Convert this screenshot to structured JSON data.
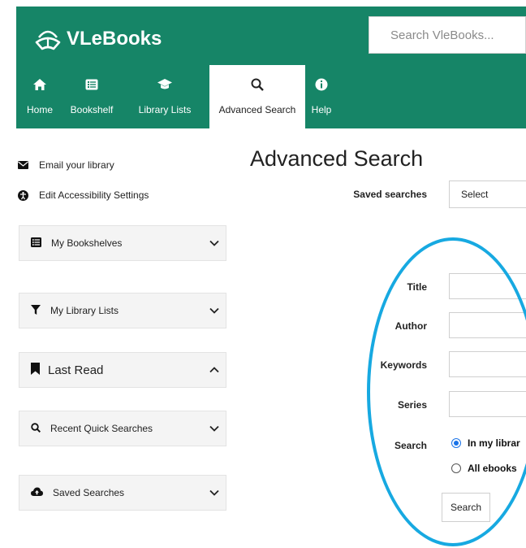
{
  "brand": {
    "name": "VLeBooks",
    "color": "#168567"
  },
  "search": {
    "placeholder": "Search VleBooks..."
  },
  "nav": [
    {
      "label": "Home",
      "icon": "home-icon"
    },
    {
      "label": "Bookshelf",
      "icon": "bookshelf-icon"
    },
    {
      "label": "Library Lists",
      "icon": "graduation-cap-icon"
    },
    {
      "label": "Advanced Search",
      "icon": "search-icon",
      "active": true
    },
    {
      "label": "Help",
      "icon": "info-icon"
    }
  ],
  "sidebar": {
    "links": [
      {
        "label": "Email your library",
        "icon": "envelope-icon"
      },
      {
        "label": "Edit Accessibility Settings",
        "icon": "accessibility-icon"
      }
    ],
    "panels": [
      {
        "label": "My Bookshelves",
        "icon": "list-icon",
        "state": "collapsed"
      },
      {
        "label": "My Library Lists",
        "icon": "filter-icon",
        "state": "collapsed"
      },
      {
        "label": "Last Read",
        "icon": "bookmark-icon",
        "state": "expanded"
      },
      {
        "label": "Recent Quick Searches",
        "icon": "search-icon",
        "state": "collapsed"
      },
      {
        "label": "Saved Searches",
        "icon": "cloud-upload-icon",
        "state": "collapsed"
      }
    ]
  },
  "main": {
    "title": "Advanced Search",
    "saved_searches": {
      "label": "Saved searches",
      "value": "Select"
    },
    "fields": [
      {
        "label": "Title",
        "value": ""
      },
      {
        "label": "Author",
        "value": ""
      },
      {
        "label": "Keywords",
        "value": ""
      },
      {
        "label": "Series",
        "value": ""
      }
    ],
    "search_scope": {
      "label": "Search",
      "options": [
        {
          "label": "In my librar",
          "selected": true
        },
        {
          "label": "All ebooks",
          "selected": false
        }
      ]
    },
    "search_button": "Search"
  },
  "annotation": {
    "color": "#17a9e1"
  }
}
